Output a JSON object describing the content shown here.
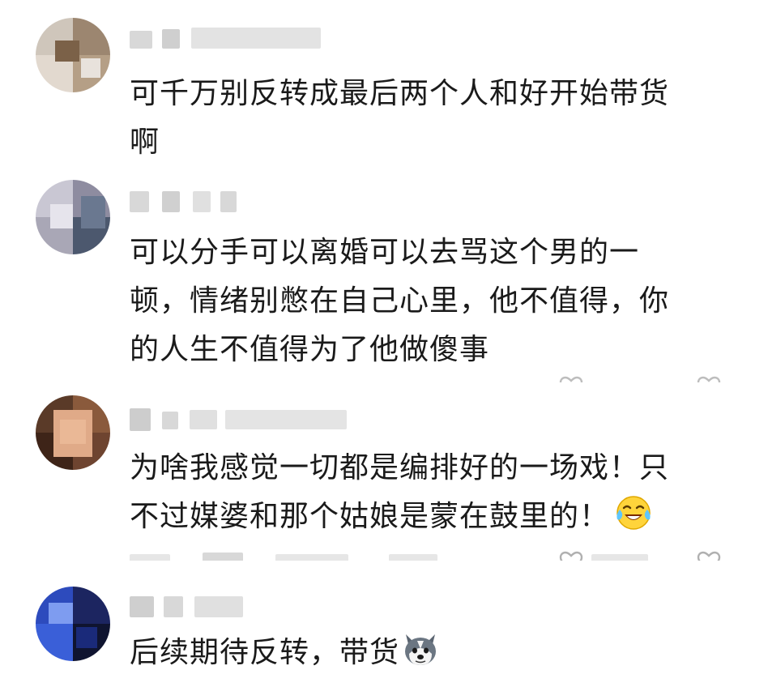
{
  "comments": [
    {
      "lines": [
        "可千万别反转成最后两个人和好开始带货",
        "啊"
      ],
      "avatar_colors": [
        "#b7a48a",
        "#8f7458",
        "#d9cfc2",
        "#6c5c4c"
      ]
    },
    {
      "lines": [
        "可以分手可以离婚可以去骂这个男的一",
        "顿，情绪别憋在自己心里，他不值得，你",
        "的人生不值得为了他做傻事"
      ],
      "avatar_colors": [
        "#9a98a8",
        "#5b5a6e",
        "#c9c7d3",
        "#3e4a64"
      ]
    },
    {
      "lines": [
        "为啥我感觉一切都是编排好的一场戏！只",
        "不过媒婆和那个姑娘是蒙在鼓里的！"
      ],
      "emoji": "tears-of-joy-emoji",
      "avatar_colors": [
        "#c89274",
        "#7a4e34",
        "#e3b89a",
        "#4a2e20"
      ]
    },
    {
      "lines": [
        "后续期待反转，带货"
      ],
      "emoji": "husky-emoji",
      "avatar_colors": [
        "#2a3d9a",
        "#5a78d8",
        "#1b2140",
        "#8ea4e8"
      ]
    }
  ]
}
